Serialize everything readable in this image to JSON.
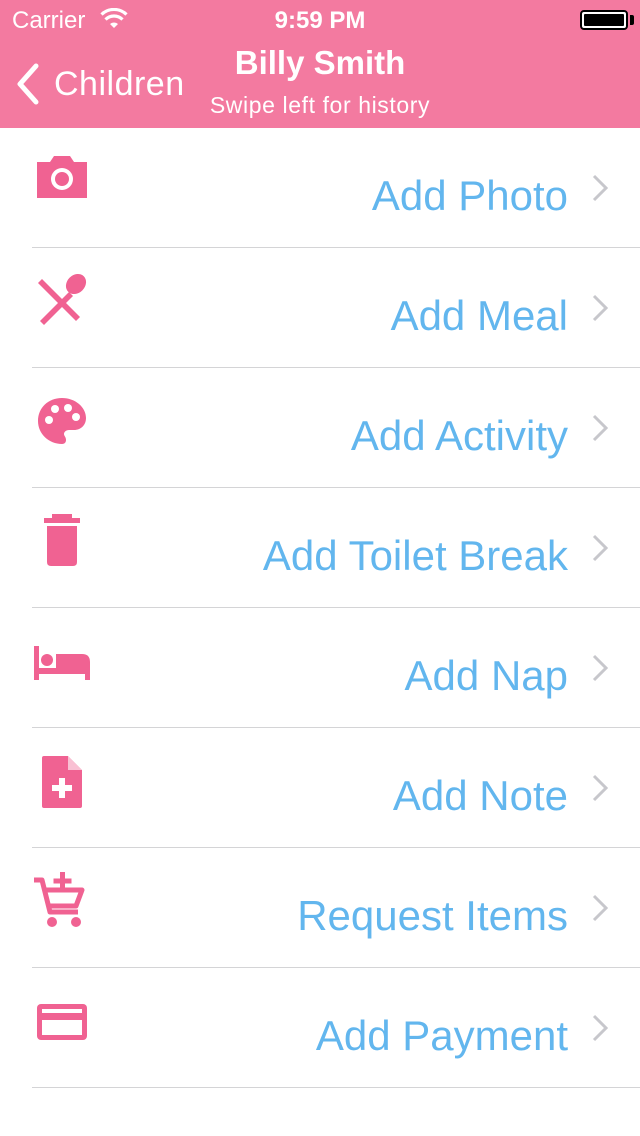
{
  "status_bar": {
    "carrier": "Carrier",
    "time": "9:59 PM"
  },
  "nav": {
    "back_label": "Children",
    "title": "Billy Smith",
    "subtitle": "Swipe left for history"
  },
  "colors": {
    "header": "#f37aa0",
    "icon": "#f06292",
    "label": "#62b6ee",
    "separator": "#d4d4d6"
  },
  "menu": {
    "items": [
      {
        "label": "Add Photo",
        "icon": "camera-icon"
      },
      {
        "label": "Add Meal",
        "icon": "utensils-icon"
      },
      {
        "label": "Add Activity",
        "icon": "palette-icon"
      },
      {
        "label": "Add Toilet Break",
        "icon": "trash-icon"
      },
      {
        "label": "Add Nap",
        "icon": "bed-icon"
      },
      {
        "label": "Add Note",
        "icon": "note-add-icon"
      },
      {
        "label": "Request Items",
        "icon": "cart-add-icon"
      },
      {
        "label": "Add Payment",
        "icon": "credit-card-icon"
      }
    ]
  }
}
